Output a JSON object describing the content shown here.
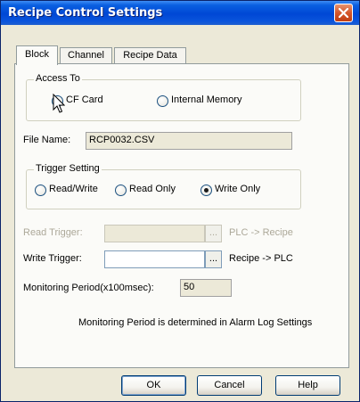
{
  "window": {
    "title": "Recipe Control Settings"
  },
  "tabs": [
    {
      "label": "Block",
      "active": true
    },
    {
      "label": "Channel",
      "active": false
    },
    {
      "label": "Recipe Data",
      "active": false
    }
  ],
  "access_to": {
    "legend": "Access To",
    "options": [
      {
        "label": "CF Card",
        "selected": true
      },
      {
        "label": "Internal Memory",
        "selected": false
      }
    ]
  },
  "file_name": {
    "label": "File Name:",
    "value": "RCP0032.CSV"
  },
  "trigger_setting": {
    "legend": "Trigger Setting",
    "options": [
      {
        "label": "Read/Write",
        "selected": false
      },
      {
        "label": "Read Only",
        "selected": false
      },
      {
        "label": "Write Only",
        "selected": true
      }
    ]
  },
  "read_trigger": {
    "label": "Read Trigger:",
    "value": "",
    "browse": "...",
    "direction": "PLC -> Recipe",
    "enabled": false
  },
  "write_trigger": {
    "label": "Write Trigger:",
    "value": "",
    "browse": "...",
    "direction": "Recipe -> PLC",
    "enabled": true
  },
  "monitoring": {
    "label": "Monitoring Period(x100msec):",
    "value": "50",
    "note": "Monitoring Period is determined in Alarm Log Settings"
  },
  "buttons": {
    "ok": "OK",
    "cancel": "Cancel",
    "help": "Help"
  },
  "colors": {
    "titlebar": "#0047d5",
    "dialog_bg": "#ece9d8",
    "close_button": "#d4562a",
    "radio_selected": "#21a121"
  }
}
